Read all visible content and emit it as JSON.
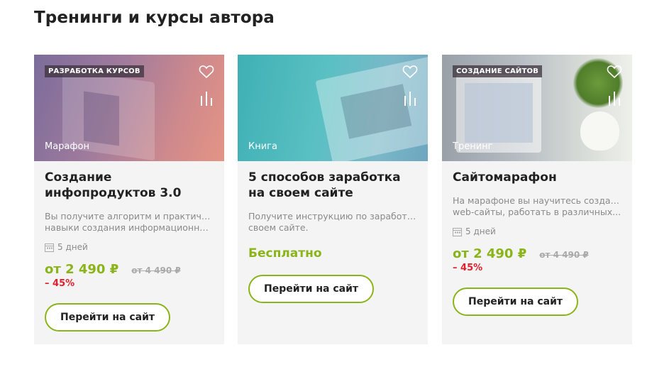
{
  "section": {
    "title": "Тренинги и курсы автора"
  },
  "colors": {
    "accent": "#8ab419",
    "discount": "#e2202d",
    "muted": "#8a8a8a"
  },
  "icons": {
    "favorite": "heart-icon",
    "stats": "bar-chart-icon",
    "duration": "calendar-icon"
  },
  "cards": [
    {
      "tag": "РАЗРАБОТКА КУРСОВ",
      "type": "Марафон",
      "title": "Создание инфопродуктов 3.0",
      "desc_line1": "Вы получите алгоритм и практические",
      "desc_line2": "навыки создания информационного...",
      "duration": "5 дней",
      "price": "от 2 490 ₽",
      "old_price": "от 4 490 ₽",
      "discount": "– 45%",
      "cta": "Перейти на сайт"
    },
    {
      "tag": "",
      "type": "Книга",
      "title": "5 способов заработка на своем сайте",
      "desc_line1": "Получите инструкцию по заработку на",
      "desc_line2": "своем сайте.",
      "price": "Бесплатно",
      "cta": "Перейти на сайт"
    },
    {
      "tag": "СОЗДАНИЕ САЙТОВ",
      "type": "Тренинг",
      "title": "Сайтомарафон",
      "desc_line1": "На марафоне вы научитесь создавать",
      "desc_line2": "web-сайты, работать в различных...",
      "duration": "5 дней",
      "price": "от 2 490 ₽",
      "old_price": "от 4 490 ₽",
      "discount": "– 45%",
      "cta": "Перейти на сайт"
    }
  ]
}
